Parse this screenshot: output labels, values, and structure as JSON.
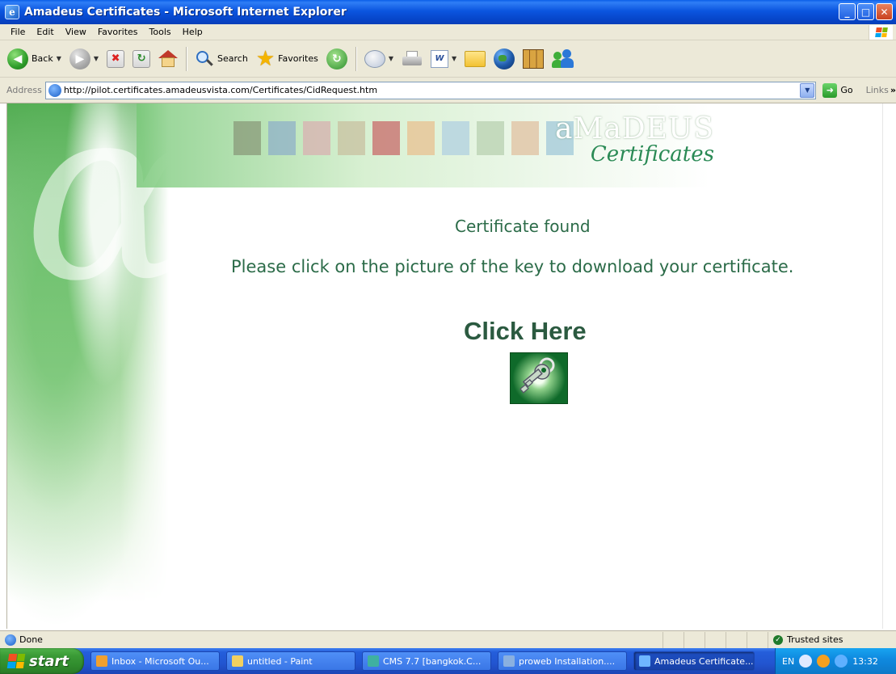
{
  "window": {
    "title": "Amadeus Certificates - Microsoft Internet Explorer",
    "controls": {
      "minimize": "_",
      "maximize": "□",
      "close": "✕"
    }
  },
  "menu": [
    "File",
    "Edit",
    "View",
    "Favorites",
    "Tools",
    "Help"
  ],
  "toolbar": {
    "back_label": "Back",
    "search_label": "Search",
    "favorites_label": "Favorites"
  },
  "address": {
    "label": "Address",
    "url": "http://pilot.certificates.amadeusvista.com/Certificates/CidRequest.htm",
    "go_label": "Go",
    "links_label": "Links"
  },
  "page": {
    "brand_name": "aMaDEUS",
    "brand_sub": "Certificates",
    "heading": "Certificate found",
    "instruction": "Please click on the picture of the key to download your certificate.",
    "click_here": "Click Here"
  },
  "status": {
    "text": "Done",
    "zone": "Trusted sites"
  },
  "taskbar": {
    "start_label": "start",
    "tasks": [
      {
        "label": "Inbox - Microsoft Ou...",
        "color": "#f0a030",
        "active": false
      },
      {
        "label": "untitled - Paint",
        "color": "#f2d060",
        "active": false
      },
      {
        "label": "CMS 7.7 [bangkok.C...",
        "color": "#3fb0a0",
        "active": false
      },
      {
        "label": "proweb Installation....",
        "color": "#8ab0e0",
        "active": false
      },
      {
        "label": "Amadeus Certificate...",
        "color": "#6fb6ff",
        "active": true
      }
    ],
    "tray": {
      "lang": "EN",
      "time": "13:32"
    }
  },
  "colors": {
    "accent_green": "#2b6b48",
    "titlebar_blue": "#0b55df",
    "taskbar_blue": "#245edb",
    "start_green": "#3a9a36"
  }
}
